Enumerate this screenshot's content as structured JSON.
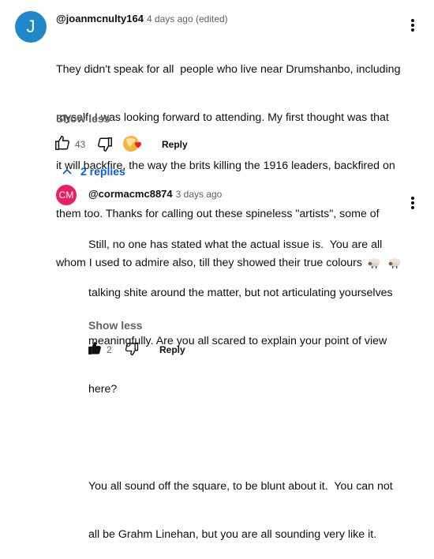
{
  "main_comment": {
    "avatar_letter": "J",
    "avatar_color": "#1e88c9",
    "handle": "@joanmcnulty164",
    "time": "4 days ago (edited)",
    "text_lines": [
      "They didn't speak for all  people who live near Drumshanbo, including",
      "myself. I was looking forward to attending. My first thought was that",
      "it will backfire, the way the brits killing the 1916 leaders, backfired on",
      "them too. Thanks for calling out these spineless \"artists\", some of",
      "whom I used to admire also, till they showed their true colours"
    ],
    "show_less": "Show less",
    "like_count": "43",
    "reply_label": "Reply"
  },
  "replies_toggle": {
    "label": "2 replies",
    "accent_color": "#065fd4"
  },
  "reply_comment": {
    "avatar_letters": "CM",
    "avatar_color": "#e91e63",
    "handle": "@cormacmc8874",
    "time": "3 days ago",
    "text_lines": [
      "Still, no one has stated what the actual issue is.  You are all",
      "talking shite around the matter, but not articulating yourselves",
      "meaningfully. Are you all scared to explain your point of view",
      "here?",
      "",
      "You all sound off the square, to be blunt about it.  You can not",
      "all be Grahm Linehan, but you are all sounding very like it."
    ],
    "show_less": "Show less",
    "like_count": "2",
    "reply_label": "Reply"
  },
  "icons": {
    "like": "thumbs-up-icon",
    "dislike": "thumbs-down-icon",
    "menu": "more-vert-icon",
    "sheep": "sheep-emoji-icon",
    "creator_heart": "creator-heart-icon",
    "chevron": "chevron-up-icon"
  }
}
